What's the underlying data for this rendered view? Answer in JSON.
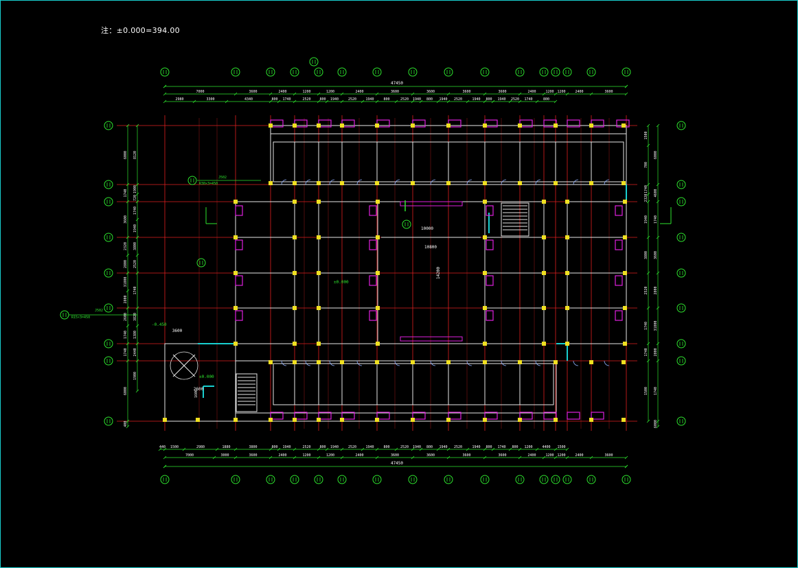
{
  "title_note": "注：±0.000=394.00",
  "colors": {
    "background": "#000000",
    "dimension": "#2ee62e",
    "axis": "#e02020",
    "wall": "#e8e8e8",
    "column": "#f0e020",
    "door_window": "#e020e0",
    "frame_border": "#19d0d0",
    "text": "#ffffff"
  },
  "axis_bubble_icon": "circle-axis-marker",
  "overall_dimension": "47450",
  "top_dims_row1": [
    "7000",
    "3600",
    "2400",
    "1200",
    "1200",
    "2400",
    "3600",
    "3600",
    "3600",
    "3600",
    "2400",
    "1200",
    "1200",
    "2400",
    "3600"
  ],
  "top_dims_row2": [
    "2980",
    "3300",
    "4340",
    "800",
    "1740",
    "2520",
    "800",
    "1940",
    "2520",
    "1940",
    "800",
    "2520",
    "1940",
    "800",
    "1940",
    "2520",
    "1940",
    "800",
    "1940",
    "2520",
    "1740",
    "800"
  ],
  "bottom_dims_row1": [
    "440",
    "1500",
    "2980",
    "1880",
    "3800",
    "800",
    "1940",
    "2520",
    "800",
    "1940",
    "2520",
    "1940",
    "800",
    "2520",
    "1940",
    "800",
    "1940",
    "2520",
    "1940",
    "800",
    "1740",
    "800",
    "1200",
    "4400",
    "1500"
  ],
  "bottom_dims_row2": [
    "7000",
    "3000",
    "3600",
    "2400",
    "1200",
    "1200",
    "2400",
    "3600",
    "3600",
    "3600",
    "3600",
    "2400",
    "1200",
    "1200",
    "2400",
    "3600"
  ],
  "left_dims_outer": [
    "6000",
    "1740",
    "3600",
    "2320",
    "2800",
    "31800",
    "2800",
    "2600",
    "1740",
    "1740",
    "6000",
    "400"
  ],
  "left_dims_inner": [
    "8120",
    "1900",
    "720",
    "1740",
    "1940",
    "3800",
    "2520",
    "1740",
    "3820",
    "1380",
    "2440",
    "1900"
  ],
  "right_dims_outer": [
    "6000",
    "4600",
    "1740",
    "3600",
    "2800",
    "31800",
    "2800",
    "1740",
    "6000",
    "4400"
  ],
  "right_dims_inner": [
    "1500",
    "700",
    "1740",
    "2320",
    "1940",
    "3800",
    "2520",
    "1740",
    "1740",
    "1500"
  ],
  "labels": {
    "elev_main": "±0.000",
    "elev_side": "-0.450",
    "elev_entrance": "±0.000",
    "courtyard_w1": "10000",
    "courtyard_w2": "10800",
    "courtyard_h": "14200",
    "ramp1_ref": "J502",
    "ramp1_size": "R30×3=450",
    "ramp2_ref": "J502",
    "ramp2_size": "R15×3=450",
    "dim_3600": "3600",
    "dim_2600": "2600",
    "dim_1600": "1600"
  }
}
